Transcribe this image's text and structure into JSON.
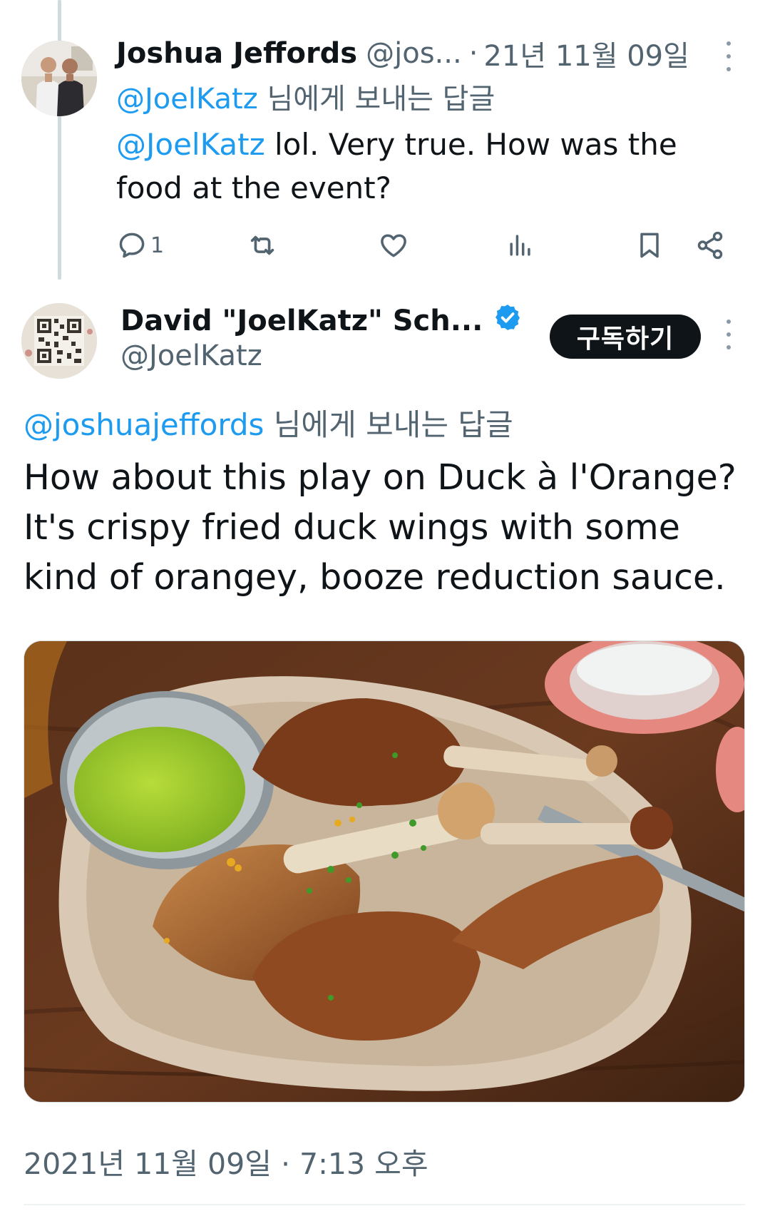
{
  "reply_tweet": {
    "author": {
      "display_name": "Joshua Jeffords",
      "handle": "@jos...",
      "avatar_icon": "avatar-photo-two-men"
    },
    "separator": "·",
    "date": "21년 11월 09일",
    "reply_to": {
      "mention": "@JoelKatz",
      "suffix": "님에게 보내는 답글"
    },
    "body": {
      "mention": "@JoelKatz",
      "text": "lol. Very true. How was the food at the event?"
    },
    "actions": {
      "reply_icon": "reply-icon",
      "reply_count": "1",
      "retweet_icon": "retweet-icon",
      "like_icon": "heart-icon",
      "views_icon": "views-icon",
      "bookmark_icon": "bookmark-icon",
      "share_icon": "share-icon"
    }
  },
  "main_tweet": {
    "author": {
      "display_name": "David \"JoelKatz\" Sch...",
      "handle": "@JoelKatz",
      "verified": true,
      "verified_color": "#1d9bf0",
      "avatar_icon": "avatar-qr-code"
    },
    "subscribe_label": "구독하기",
    "reply_to": {
      "mention": "@joshuajeffords",
      "suffix": "님에게 보내는 답글"
    },
    "body_lines": [
      "How about this play on Duck à l'Orange?",
      "It's crispy fried duck wings with some",
      "kind of orangey, booze reduction sauce."
    ],
    "media": {
      "type": "photo",
      "description_icon": "food-photo-fried-duck-wings-with-green-sauce"
    },
    "timestamp": "2021년 11월 09일 · 7:13 오후"
  },
  "colors": {
    "link": "#1d9bf0",
    "secondary_text": "#536471",
    "primary_text": "#0f1419",
    "subscribe_bg": "#0f1419"
  }
}
